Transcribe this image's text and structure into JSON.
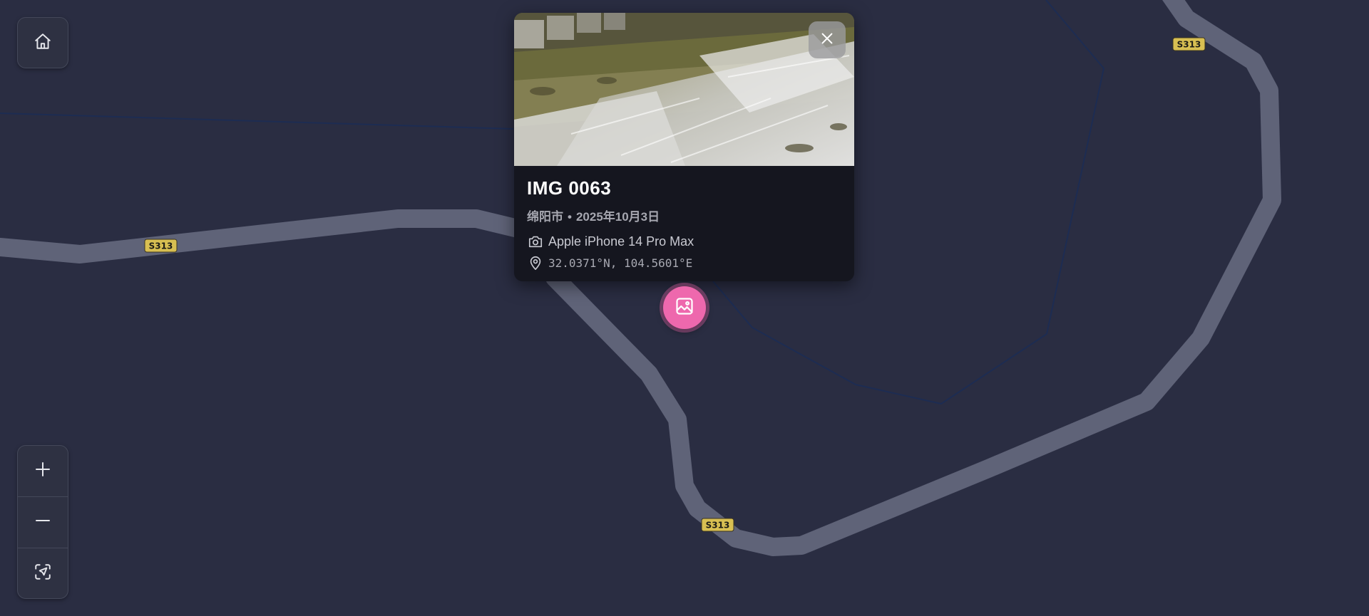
{
  "map": {
    "road_labels": [
      "S313",
      "S313",
      "S313"
    ]
  },
  "controls": {
    "home_icon": "home-icon",
    "zoom_in_icon": "plus-icon",
    "zoom_out_icon": "minus-icon",
    "locate_icon": "locate-icon"
  },
  "popup": {
    "title": "IMG 0063",
    "city": "绵阳市",
    "separator": "•",
    "date": "2025年10月3日",
    "camera": "Apple iPhone 14 Pro Max",
    "coordinates": "32.0371°N, 104.5601°E",
    "close_icon": "close-icon",
    "photo_alt": "waterfall photo"
  },
  "marker": {
    "icon": "image-icon",
    "color": "#ee68ad"
  },
  "colors": {
    "background": "#2a2d42",
    "road": "#5f6378",
    "shield": "#d8bf52",
    "waterway": "#1d2c52"
  }
}
